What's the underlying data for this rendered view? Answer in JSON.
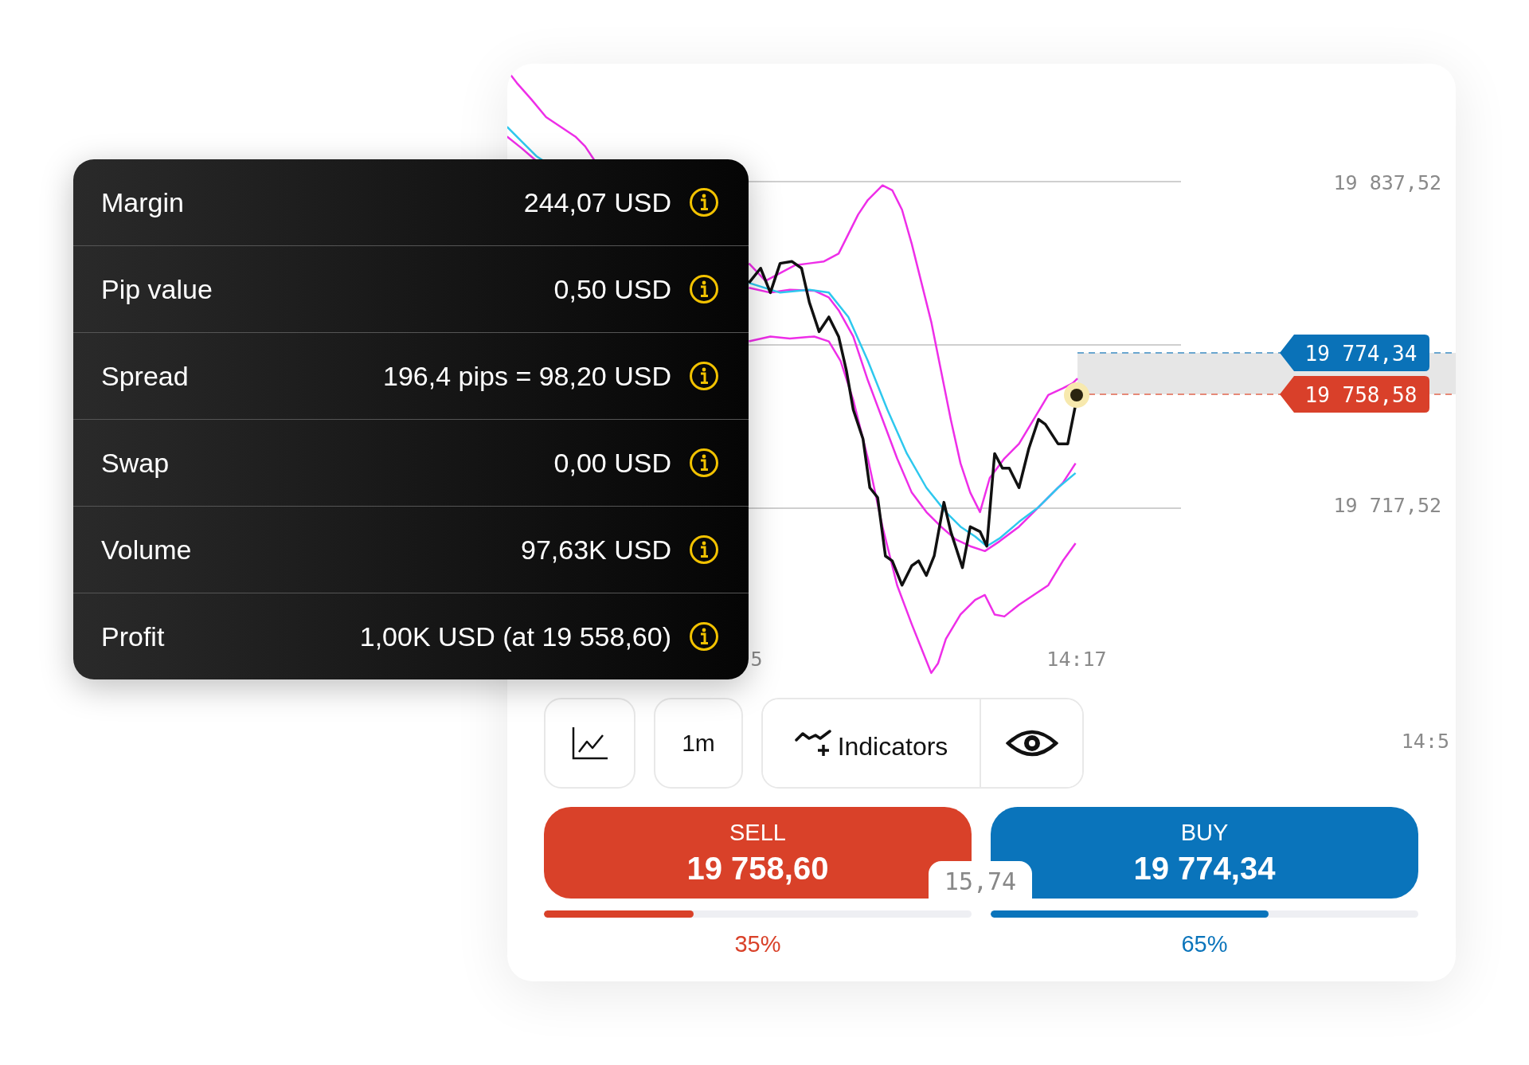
{
  "info_panel": {
    "rows": [
      {
        "label": "Margin",
        "value": "244,07 USD"
      },
      {
        "label": "Pip value",
        "value": "0,50 USD"
      },
      {
        "label": "Spread",
        "value": "196,4 pips = 98,20 USD"
      },
      {
        "label": "Swap",
        "value": "0,00 USD"
      },
      {
        "label": "Volume",
        "value": "97,63K USD"
      },
      {
        "label": "Profit",
        "value": "1,00K USD (at 19 558,60)"
      }
    ]
  },
  "chart": {
    "price_axis": [
      "19 837,52",
      "19 717,52"
    ],
    "time_axis": [
      "5",
      "14:17"
    ],
    "ask_tag": "19 774,34",
    "bid_tag": "19 758,58"
  },
  "toolbar": {
    "timeframe": "1m",
    "indicators": "Indicators",
    "time_label": "14:5"
  },
  "trade": {
    "sell": {
      "label": "SELL",
      "price": "19 758,60",
      "level": 0.35,
      "share": "35%"
    },
    "buy": {
      "label": "BUY",
      "price": "19 774,34",
      "level": 0.65,
      "share": "65%"
    },
    "spread": "15,74"
  }
}
